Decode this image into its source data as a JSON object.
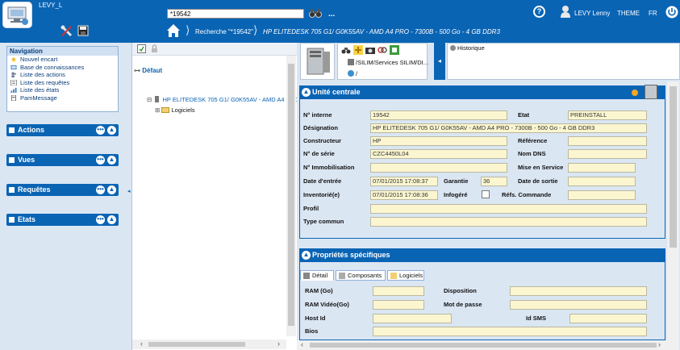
{
  "topbar": {
    "app_name": "LEVY_L",
    "search_value": "*19542",
    "search_more": "...",
    "user_name": "LEVY Lenny",
    "theme": "THEME",
    "lang": "FR",
    "colors": {
      "bar": "#0a64b4"
    }
  },
  "breadcrumb": {
    "search": "Recherche \"*19542\"",
    "item": "HP ELITEDESK 705 G1/ G0K55AV - AMD A4 PRO - 7300B - 500 Go - 4 GB DDR3"
  },
  "sidebar": {
    "navigation": {
      "title": "Navigation",
      "items": [
        {
          "label": "Nouvel encart",
          "icon": "star-icon"
        },
        {
          "label": "Base de connaissances",
          "icon": "book-icon"
        },
        {
          "label": "Liste des actions",
          "icon": "people-icon"
        },
        {
          "label": "Liste des requêtes",
          "icon": "list-icon"
        },
        {
          "label": "Liste des états",
          "icon": "chart-icon"
        },
        {
          "label": "PamMessage",
          "icon": "document-icon"
        }
      ]
    },
    "panels": [
      {
        "label": "Actions"
      },
      {
        "label": "Vues"
      },
      {
        "label": "Requêtes"
      },
      {
        "label": "Etats"
      }
    ]
  },
  "tree": {
    "default_label": "Défaut",
    "node_label": "HP ELITEDESK 705 G1/ G0K55AV - AMD A4 PRO -",
    "sub_label": "Logiciels",
    "expand_symbol": "⊟",
    "sub_expand_symbol": "⊞"
  },
  "right": {
    "path": "/SILIM/Services SILIM/DI...",
    "path2": "/",
    "historique": "Historique",
    "unite": {
      "title": "Unité centrale",
      "fields": {
        "num_interne": {
          "label": "N° interne",
          "value": "19542"
        },
        "etat": {
          "label": "Etat",
          "value": "PREINSTALL"
        },
        "designation": {
          "label": "Désignation",
          "value": "HP ELITEDESK 705 G1/ G0K55AV - AMD A4 PRO - 7300B - 500 Go - 4 GB DDR3"
        },
        "constructeur": {
          "label": "Constructeur",
          "value": "HP"
        },
        "reference": {
          "label": "Référence",
          "value": ""
        },
        "num_serie": {
          "label": "N° de série",
          "value": "CZC4450L04"
        },
        "nom_dns": {
          "label": "Nom DNS",
          "value": ""
        },
        "immobilisation": {
          "label": "N° Immobilisation",
          "value": ""
        },
        "mise_service": {
          "label": "Mise en Service",
          "value": ""
        },
        "date_entree": {
          "label": "Date d'entrée",
          "value": "07/01/2015 17:08:37"
        },
        "garantie": {
          "label": "Garantie",
          "value": "36"
        },
        "date_sortie": {
          "label": "Date de sortie",
          "value": ""
        },
        "inventorie": {
          "label": "Inventorié(e)",
          "value": "07/01/2015 17:08:36"
        },
        "infogere": {
          "label": "Infogéré"
        },
        "refs_commande": {
          "label": "Réfs. Commande",
          "value": ""
        },
        "profil": {
          "label": "Profil",
          "value": ""
        },
        "type_commun": {
          "label": "Type commun",
          "value": ""
        }
      }
    },
    "props": {
      "title": "Propriétés spécifiques",
      "tabs": [
        {
          "label": "Détail"
        },
        {
          "label": "Composants"
        },
        {
          "label": "Logiciels"
        }
      ],
      "fields": {
        "ram": {
          "label": "RAM (Go)",
          "value": ""
        },
        "disposition": {
          "label": "Disposition",
          "value": ""
        },
        "ram_video": {
          "label": "RAM Vidéo(Go)",
          "value": ""
        },
        "mot_de_passe": {
          "label": "Mot de passe",
          "value": ""
        },
        "host_id": {
          "label": "Host Id",
          "value": ""
        },
        "id_sms": {
          "label": "Id SMS",
          "value": ""
        },
        "bios": {
          "label": "Bios",
          "value": ""
        }
      }
    }
  }
}
